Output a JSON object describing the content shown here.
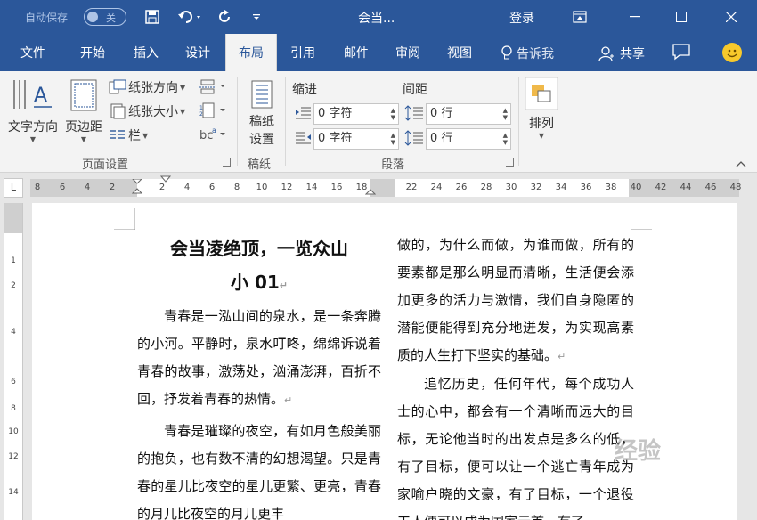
{
  "titlebar": {
    "autosave_label": "自动保存",
    "autosave_state": "关",
    "doc_title": "会当...",
    "login_label": "登录"
  },
  "tabs": {
    "items": [
      "文件",
      "开始",
      "插入",
      "设计",
      "布局",
      "引用",
      "邮件",
      "审阅",
      "视图"
    ],
    "active": "布局",
    "tell_me": "告诉我",
    "share": "共享"
  },
  "ribbon": {
    "page_setup": {
      "text_direction": "文字方向",
      "margins": "页边距",
      "orientation": "纸张方向",
      "size": "纸张大小",
      "columns": "栏",
      "label": "页面设置"
    },
    "draft": {
      "draft_settings_line1": "稿纸",
      "draft_settings_line2": "设置",
      "label": "稿纸"
    },
    "paragraph": {
      "indent_label": "缩进",
      "spacing_label": "间距",
      "indent_left": "0 字符",
      "indent_right": "0 字符",
      "spacing_before": "0 行",
      "spacing_after": "0 行",
      "label": "段落"
    },
    "arrange": {
      "label": "排列"
    }
  },
  "ruler": {
    "corner": "L",
    "left_numbers": [
      "8",
      "6",
      "4",
      "2"
    ],
    "middle_numbers": [
      "2",
      "4",
      "6",
      "8",
      "10",
      "12",
      "14",
      "16",
      "18"
    ],
    "right_numbers": [
      "22",
      "24",
      "26",
      "28",
      "30",
      "32",
      "34",
      "36",
      "38"
    ],
    "far_right_numbers": [
      "40",
      "42",
      "44",
      "46",
      "48"
    ],
    "vertical_numbers": [
      "1",
      "2",
      "4",
      "6",
      "8",
      "10",
      "12",
      "14"
    ]
  },
  "document": {
    "title_line1": "会当凌绝顶，一览众山",
    "title_line2": "小 01",
    "col1_p1": "青春是一泓山间的泉水，是一条奔腾的小河。平静时，泉水叮咚，绵绵诉说着青春的故事，激荡处，汹涌澎湃，百折不回，抒发着青春的热情。",
    "col1_p2": "青春是璀璨的夜空，有如月色般美丽的抱负，也有数不清的幻想渴望。只是青春的星儿比夜空的星儿更繁、更亮，青春的月儿比夜空的月儿更丰",
    "col2_p1": "做的，为什么而做，为谁而做，所有的要素都是那么明显而清晰，生活便会添加更多的活力与激情，我们自身隐匿的潜能便能得到充分地迸发，为实现高素质的人生打下坚实的基础。",
    "col2_p2": "追忆历史，任何年代，每个成功人士的心中，都会有一个清晰而远大的目标，无论他当时的出发点是多么的低，有了目标，便可以让一个逃亡青年成为家喻户晓的文豪，有了目标，一个退役工人便可以成为国家元首，有了",
    "watermark": "经验"
  }
}
